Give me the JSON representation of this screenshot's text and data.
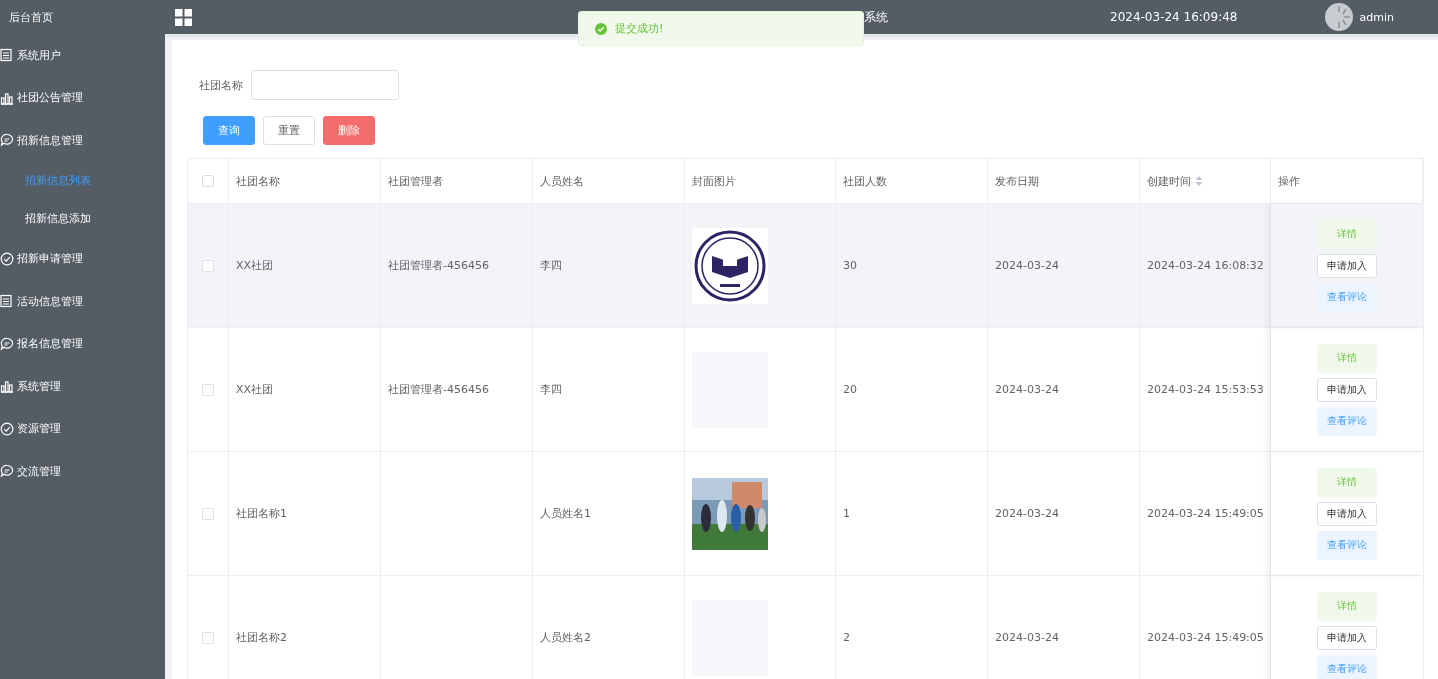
{
  "sidebar": {
    "items": [
      {
        "label": "后台首页",
        "kind": "plain"
      },
      {
        "label": "系统用户",
        "kind": "list"
      },
      {
        "label": "社团公告管理",
        "kind": "chart"
      },
      {
        "label": "招新信息管理",
        "kind": "chat",
        "children": [
          {
            "label": "招新信息列表",
            "selected": true
          },
          {
            "label": "招新信息添加",
            "selected": false
          }
        ]
      },
      {
        "label": "招新申请管理",
        "kind": "check"
      },
      {
        "label": "活动信息管理",
        "kind": "list"
      },
      {
        "label": "报名信息管理",
        "kind": "chat"
      },
      {
        "label": "系统管理",
        "kind": "chart"
      },
      {
        "label": "资源管理",
        "kind": "check"
      },
      {
        "label": "交流管理",
        "kind": "chat"
      }
    ]
  },
  "header": {
    "title": "系统",
    "datetime": "2024-03-24 16:09:48",
    "user": "admin"
  },
  "toast": {
    "message": "提交成功!"
  },
  "search": {
    "label": "社团名称"
  },
  "actions": [
    {
      "label": "查询",
      "kind": "primary"
    },
    {
      "label": "重置",
      "kind": "default"
    },
    {
      "label": "删除",
      "kind": "danger"
    }
  ],
  "table": {
    "select_all": {
      "checked": false
    },
    "columns": [
      {
        "label": "社团名称",
        "sortable": false
      },
      {
        "label": "社团管理者",
        "sortable": false
      },
      {
        "label": "人员姓名",
        "sortable": false
      },
      {
        "label": "封面图片",
        "sortable": false
      },
      {
        "label": "社团人数",
        "sortable": false
      },
      {
        "label": "发布日期",
        "sortable": false
      },
      {
        "label": "创建时间",
        "sortable": true
      },
      {
        "label": "操作",
        "sortable": false
      }
    ],
    "rows": [
      {
        "checked": false,
        "highlighted": true,
        "club": "XX社团",
        "manager": "社团管理者-456456",
        "person": "李四",
        "cover": {
          "kind": "logo"
        },
        "members": "30",
        "date": "2024-03-24",
        "created": "2024-03-24 16:08:32",
        "buttons": [
          {
            "label": "详情",
            "kind": "success"
          },
          {
            "label": "申请加入",
            "kind": "default"
          },
          {
            "label": "查看评论",
            "kind": "info"
          }
        ]
      },
      {
        "checked": false,
        "highlighted": false,
        "club": "XX社团",
        "manager": "社团管理者-456456",
        "person": "李四",
        "cover": {
          "kind": "blank"
        },
        "members": "20",
        "date": "2024-03-24",
        "created": "2024-03-24 15:53:53",
        "buttons": [
          {
            "label": "详情",
            "kind": "success"
          },
          {
            "label": "申请加入",
            "kind": "default"
          },
          {
            "label": "查看评论",
            "kind": "info"
          }
        ]
      },
      {
        "checked": false,
        "highlighted": false,
        "club": "社团名称1",
        "person": "人员姓名1",
        "cover": {
          "kind": "picture"
        },
        "members": "1",
        "date": "2024-03-24",
        "created": "2024-03-24 15:49:05",
        "buttons": [
          {
            "label": "详情",
            "kind": "success"
          },
          {
            "label": "申请加入",
            "kind": "default"
          },
          {
            "label": "查看评论",
            "kind": "info"
          }
        ]
      },
      {
        "checked": false,
        "highlighted": false,
        "club": "社团名称2",
        "person": "人员姓名2",
        "cover": {
          "kind": "blank"
        },
        "members": "2",
        "date": "2024-03-24",
        "created": "2024-03-24 15:49:05",
        "buttons": [
          {
            "label": "详情",
            "kind": "success"
          },
          {
            "label": "申请加入",
            "kind": "default"
          },
          {
            "label": "查看评论",
            "kind": "info"
          }
        ]
      }
    ]
  }
}
